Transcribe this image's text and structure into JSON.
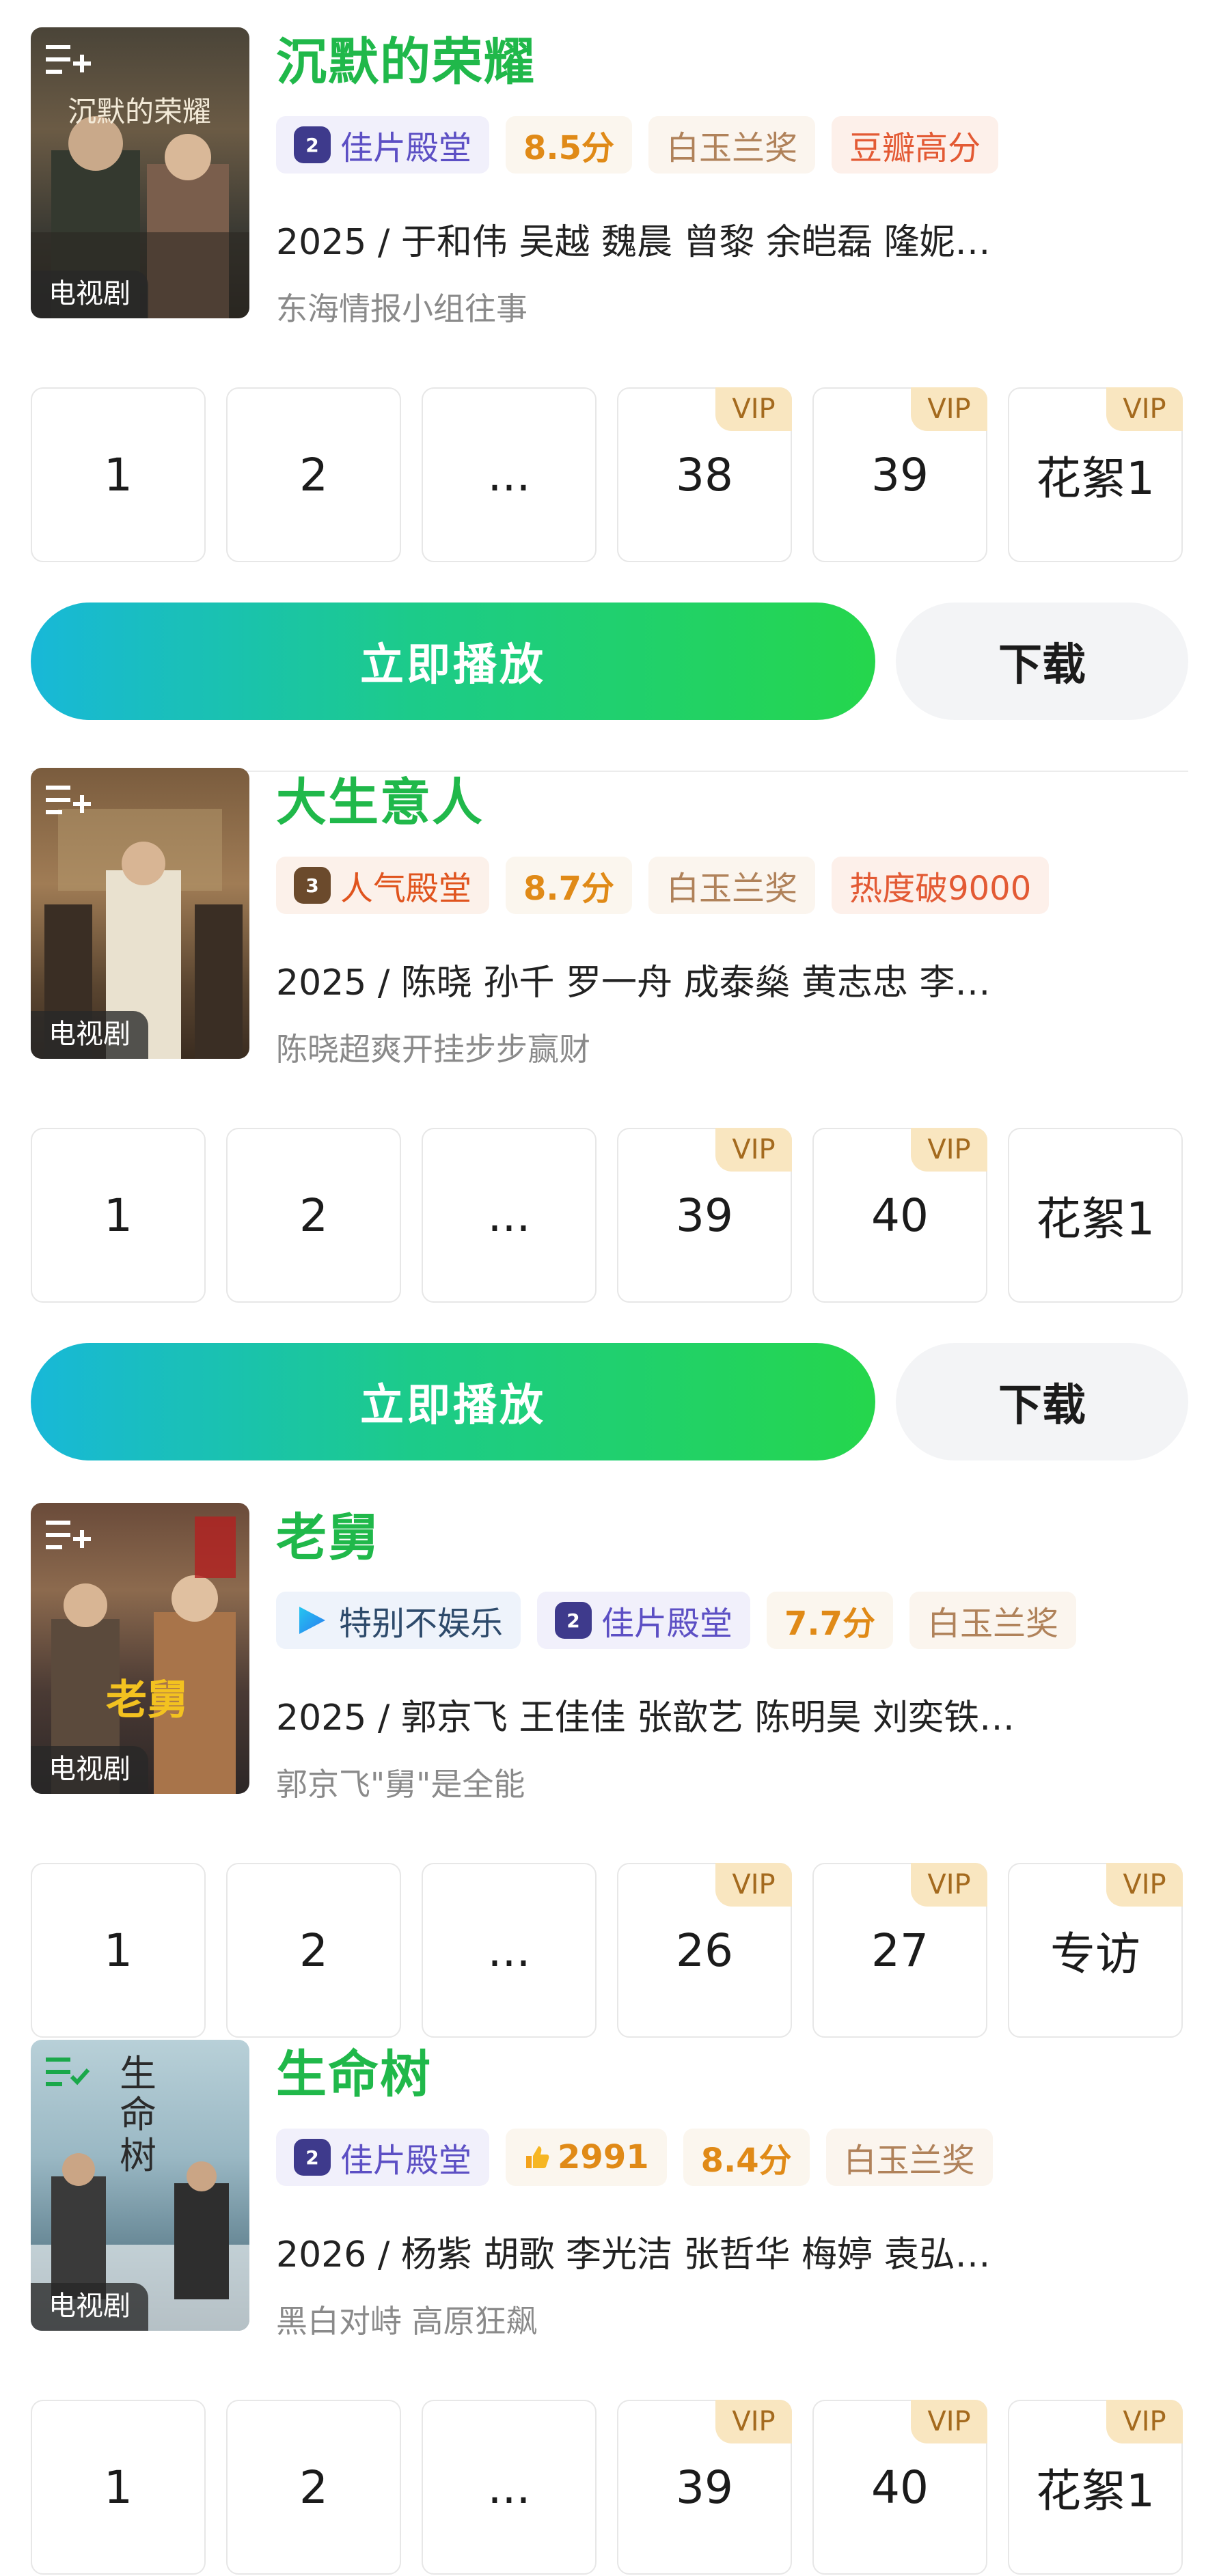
{
  "colors": {
    "title_green": "#20b84a",
    "hall_purple": "#5c4fc4",
    "score_orange": "#e08a17",
    "vip_gold": "#f9e6c0"
  },
  "shows": [
    {
      "title": "沉默的荣耀",
      "poster_type": "电视剧",
      "poster_text": "沉默的荣耀",
      "badges": [
        {
          "kind": "hall",
          "icon": "rank-2-icon",
          "icon_text": "2",
          "text": "佳片殿堂"
        },
        {
          "kind": "score",
          "text": "8.5分"
        },
        {
          "kind": "award",
          "text": "白玉兰奖"
        },
        {
          "kind": "douban",
          "text": "豆瓣高分"
        }
      ],
      "cast": "2025 / 于和伟  吴越  魏晨  曾黎  余皑磊  隆妮…",
      "desc": "东海情报小组往事",
      "episodes": [
        {
          "label": "1",
          "vip": ""
        },
        {
          "label": "2",
          "vip": ""
        },
        {
          "label": "...",
          "vip": ""
        },
        {
          "label": "38",
          "vip": "VIP"
        },
        {
          "label": "39",
          "vip": "VIP"
        },
        {
          "label": "花絮1",
          "vip": "VIP"
        }
      ],
      "play_label": "立即播放",
      "download_label": "下载"
    },
    {
      "title": "大生意人",
      "poster_type": "电视剧",
      "poster_text": "",
      "badges": [
        {
          "kind": "hall",
          "icon": "rank-3-icon",
          "icon_text": "3",
          "text": "人气殿堂"
        },
        {
          "kind": "score",
          "text": "8.7分"
        },
        {
          "kind": "award",
          "text": "白玉兰奖"
        },
        {
          "kind": "douban",
          "text": "热度破9000"
        }
      ],
      "cast": "2025 / 陈晓  孙千  罗一舟  成泰燊  黄志忠  李…",
      "desc": "陈晓超爽开挂步步赢财",
      "episodes": [
        {
          "label": "1",
          "vip": ""
        },
        {
          "label": "2",
          "vip": ""
        },
        {
          "label": "...",
          "vip": ""
        },
        {
          "label": "39",
          "vip": "VIP"
        },
        {
          "label": "40",
          "vip": "VIP"
        },
        {
          "label": "花絮1",
          "vip": ""
        }
      ],
      "play_label": "立即播放",
      "download_label": "下载"
    },
    {
      "title": "老舅",
      "poster_type": "电视剧",
      "poster_text": "老舅",
      "badges": [
        {
          "kind": "special",
          "icon": "play-arrow-icon",
          "text": "特别不娱乐"
        },
        {
          "kind": "hall",
          "icon": "rank-2-icon",
          "icon_text": "2",
          "text": "佳片殿堂"
        },
        {
          "kind": "score",
          "text": "7.7分"
        },
        {
          "kind": "award",
          "text": "白玉兰奖"
        }
      ],
      "cast": "2025 / 郭京飞  王佳佳  张歆艺  陈明昊  刘奕铁…",
      "desc": "郭京飞\"舅\"是全能",
      "episodes": [
        {
          "label": "1",
          "vip": ""
        },
        {
          "label": "2",
          "vip": ""
        },
        {
          "label": "...",
          "vip": ""
        },
        {
          "label": "26",
          "vip": "VIP"
        },
        {
          "label": "27",
          "vip": "VIP"
        },
        {
          "label": "专访",
          "vip": "VIP"
        }
      ]
    },
    {
      "title": "生命树",
      "poster_type": "电视剧",
      "poster_text": "生命树",
      "badges": [
        {
          "kind": "hall",
          "icon": "rank-2-icon",
          "icon_text": "2",
          "text": "佳片殿堂"
        },
        {
          "kind": "heat",
          "icon": "thumb-up-icon",
          "text": "2991"
        },
        {
          "kind": "score",
          "text": "8.4分"
        },
        {
          "kind": "award",
          "text": "白玉兰奖"
        }
      ],
      "cast": "2026 / 杨紫  胡歌  李光洁  张哲华  梅婷  袁弘…",
      "desc": "黑白对峙 高原狂飙",
      "episodes": [
        {
          "label": "1",
          "vip": ""
        },
        {
          "label": "2",
          "vip": ""
        },
        {
          "label": "...",
          "vip": ""
        },
        {
          "label": "39",
          "vip": "VIP"
        },
        {
          "label": "40",
          "vip": "VIP"
        },
        {
          "label": "花絮1",
          "vip": "VIP"
        }
      ]
    }
  ]
}
